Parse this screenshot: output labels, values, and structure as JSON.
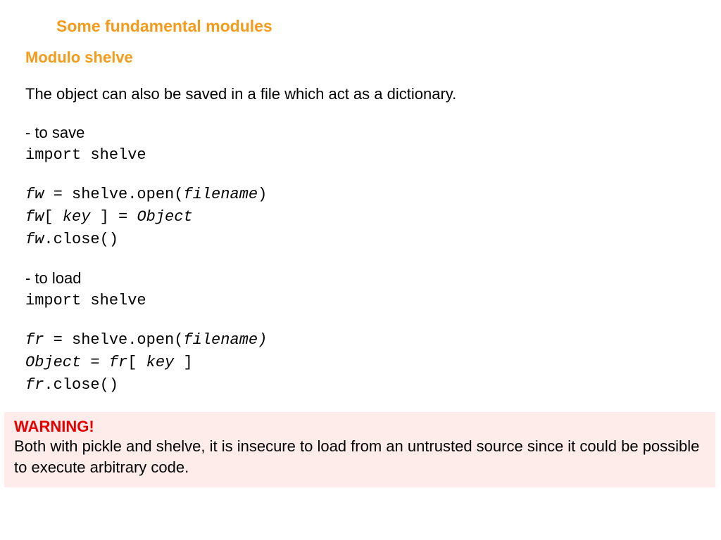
{
  "header": {
    "page_title": "Some fundamental modules",
    "section_title": "Modulo shelve"
  },
  "intro": "The object can also be saved in a file which act as a dictionary.",
  "save": {
    "label": "- to save",
    "line1": "import shelve",
    "line2a": "fw",
    "line2b": " = shelve.open(",
    "line2c": "filename",
    "line2d": ")",
    "line3a": "fw",
    "line3b": "[ ",
    "line3c": "key",
    "line3d": " ] = ",
    "line3e": "Object",
    "line4a": "fw",
    "line4b": ".close()"
  },
  "load": {
    "label": "- to load",
    "line1": "import shelve",
    "line2a": "fr",
    "line2b": " = shelve.open(",
    "line2c": "filename)",
    "line3a": "Object",
    "line3b": " = ",
    "line3c": "fr",
    "line3d": "[ ",
    "line3e": "key",
    "line3f": " ]",
    "line4a": "fr",
    "line4b": ".close()"
  },
  "warning": {
    "label": "WARNING!",
    "text": "Both with pickle and shelve, it is insecure to load from an untrusted source since it could be possible to execute arbitrary code."
  }
}
